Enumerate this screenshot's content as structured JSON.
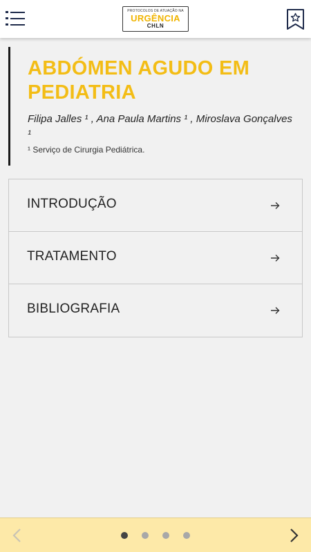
{
  "header": {
    "menu_icon": "list-menu-icon",
    "logo": {
      "line1": "PROTOCOLOS DE ATUAÇÃO NA",
      "line2": "URGÊNCIA",
      "line3": "CHLN"
    },
    "bookmark_icon": "bookmark-star-icon"
  },
  "article": {
    "title": "ABDÓMEN AGUDO EM PEDIATRIA",
    "authors": "Filipa Jalles ¹ , Ana Paula Martins ¹ , Miroslava Gonçalves ¹",
    "affiliation": "¹ Serviço de Cirurgia Pediátrica."
  },
  "sections": [
    {
      "label": "INTRODUÇÃO",
      "icon": "arrow-right-icon"
    },
    {
      "label": "TRATAMENTO",
      "icon": "arrow-right-icon"
    },
    {
      "label": "BIBLIOGRAFIA",
      "icon": "arrow-right-icon"
    }
  ],
  "pager": {
    "pages": 4,
    "current": 1,
    "prev_icon": "chevron-left-icon",
    "next_icon": "chevron-right-icon"
  },
  "colors": {
    "accent": "#f3bd16",
    "bottom_bar": "#fde9a8",
    "background": "#f1f1f1"
  }
}
